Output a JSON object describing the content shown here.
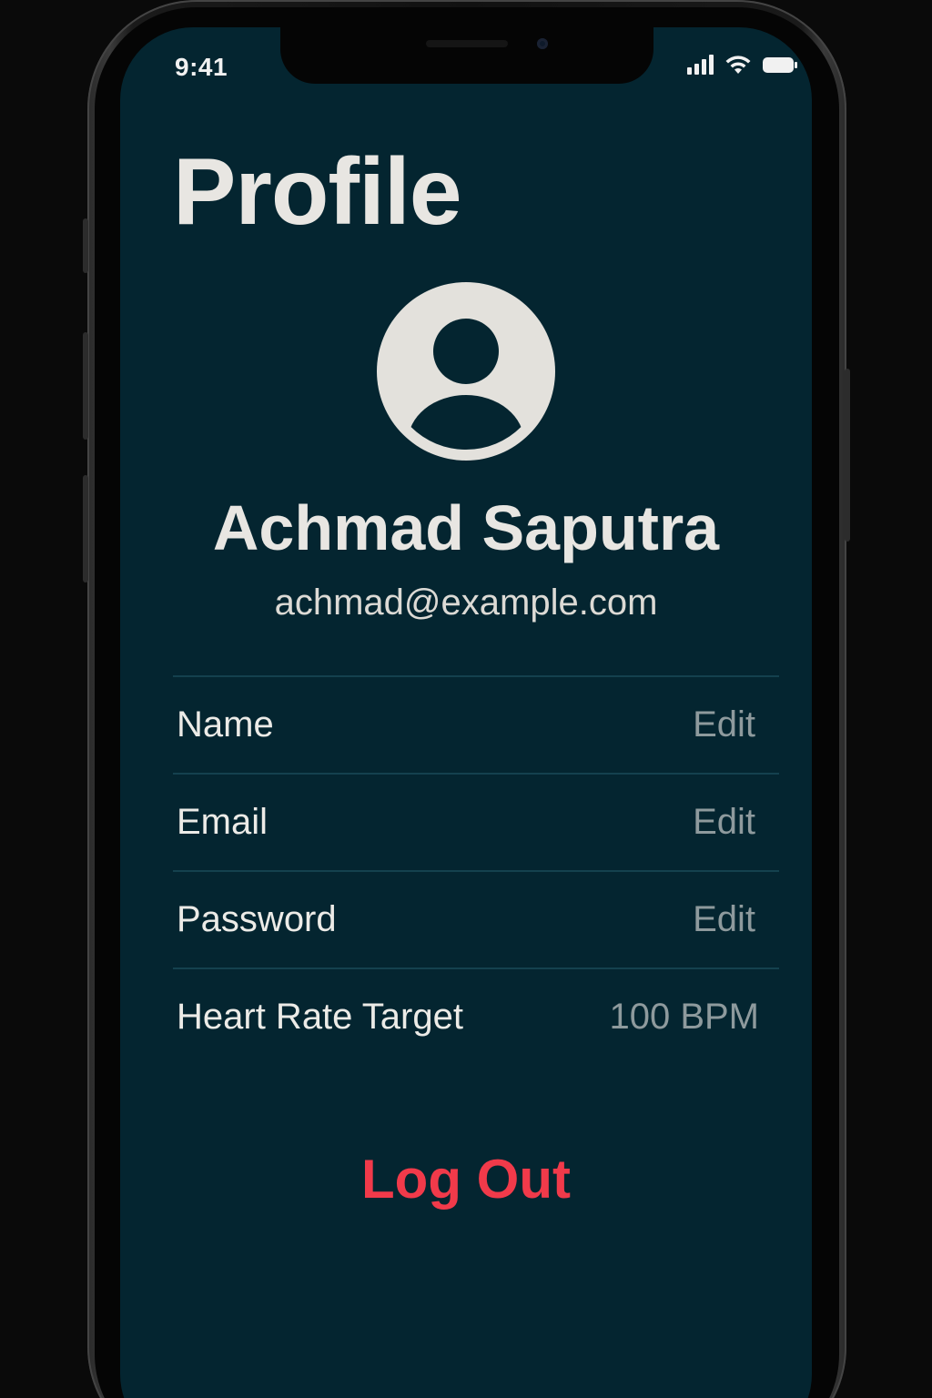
{
  "status_bar": {
    "time": "9:41"
  },
  "page": {
    "title": "Profile"
  },
  "user": {
    "name": "Achmad Saputra",
    "email": "achmad@example.com"
  },
  "settings": {
    "items": [
      {
        "label": "Name",
        "action": "Edit"
      },
      {
        "label": "Email",
        "action": "Edit"
      },
      {
        "label": "Password",
        "action": "Edit"
      },
      {
        "label": "Heart Rate Target",
        "value": "100 BPM"
      }
    ]
  },
  "actions": {
    "logout_label": "Log Out"
  },
  "colors": {
    "screen_background": "#042530",
    "primary_text": "#e8e6e2",
    "secondary_text": "#8e9a9d",
    "destructive": "#f13a4a",
    "divider": "#14414e"
  },
  "icons": {
    "avatar": "person-circle-icon",
    "signal": "cellular-signal-icon",
    "wifi": "wifi-icon",
    "battery": "battery-icon"
  }
}
